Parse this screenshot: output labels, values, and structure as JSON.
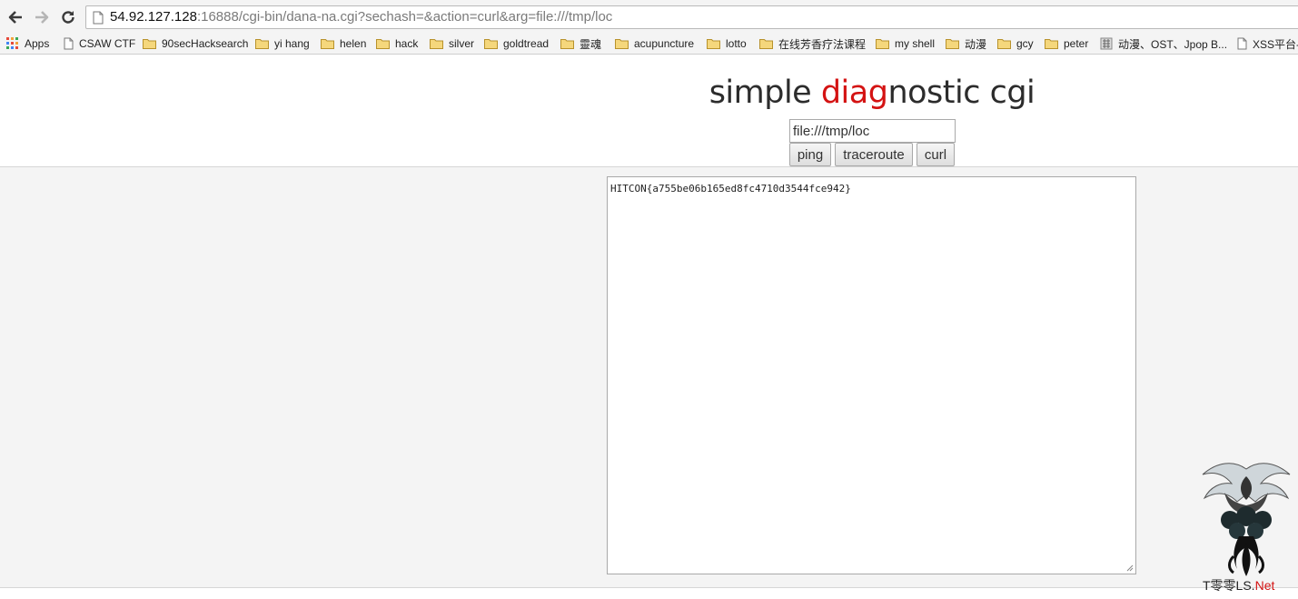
{
  "browser": {
    "url_host": "54.92.127.128",
    "url_rest": ":16888/cgi-bin/dana-na.cgi?sechash=&action=curl&arg=file:///tmp/loc",
    "back_icon": "back-arrow-icon",
    "forward_icon": "forward-arrow-icon",
    "reload_icon": "reload-icon"
  },
  "bookmarks": [
    {
      "label": "Apps",
      "icon": "apps-grid-icon"
    },
    {
      "label": "CSAW CTF",
      "icon": "page-icon"
    },
    {
      "label": "90secHacksearch",
      "icon": "folder-icon"
    },
    {
      "label": "yi hang",
      "icon": "folder-icon"
    },
    {
      "label": "helen",
      "icon": "folder-icon"
    },
    {
      "label": "hack",
      "icon": "folder-icon"
    },
    {
      "label": "silver",
      "icon": "folder-icon"
    },
    {
      "label": "goldtread",
      "icon": "folder-icon"
    },
    {
      "label": "靈魂",
      "icon": "folder-icon"
    },
    {
      "label": "acupuncture",
      "icon": "folder-icon"
    },
    {
      "label": "lotto",
      "icon": "folder-icon"
    },
    {
      "label": "在线芳香疗法课程",
      "icon": "folder-icon"
    },
    {
      "label": "my shell",
      "icon": "folder-icon"
    },
    {
      "label": "动漫",
      "icon": "folder-icon"
    },
    {
      "label": "gcy",
      "icon": "folder-icon"
    },
    {
      "label": "peter",
      "icon": "folder-icon"
    },
    {
      "label": "动漫、OST、Jpop B...",
      "icon": "site-favicon"
    },
    {
      "label": "XSS平台-",
      "icon": "page-icon"
    }
  ],
  "page": {
    "title_a": "simple ",
    "title_b": "diag",
    "title_c": "nostic cgi",
    "arg_value": "file:///tmp/loc",
    "buttons": [
      "ping",
      "traceroute",
      "curl"
    ],
    "output": "HITCON{a755be06b165ed8fc4710d3544fce942}"
  },
  "watermark": {
    "text_a": "T零零LS.",
    "text_b": "Net"
  },
  "colors": {
    "accent_red": "#d41313",
    "folder_yellow": "#e8c15a"
  }
}
